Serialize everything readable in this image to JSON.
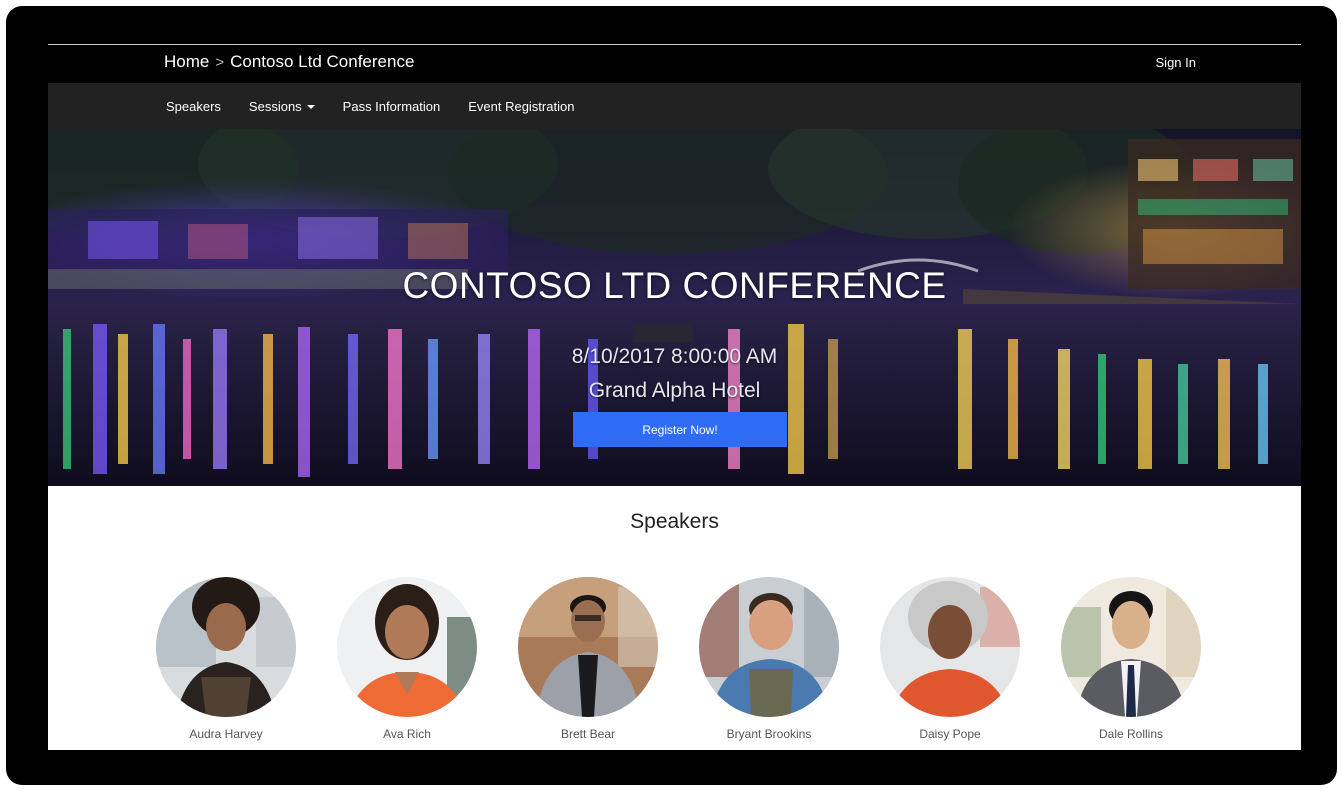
{
  "breadcrumb": {
    "home": "Home",
    "separator": ">",
    "current": "Contoso Ltd Conference"
  },
  "header": {
    "sign_in": "Sign In"
  },
  "nav": {
    "speakers": "Speakers",
    "sessions": "Sessions",
    "pass_information": "Pass Information",
    "event_registration": "Event Registration"
  },
  "hero": {
    "title": "CONTOSO LTD CONFERENCE",
    "date": "8/10/2017 8:00:00 AM",
    "venue": "Grand Alpha Hotel",
    "register_label": "Register Now!"
  },
  "speakers_section": {
    "heading": "Speakers",
    "items": [
      {
        "name": "Audra Harvey"
      },
      {
        "name": "Ava Rich"
      },
      {
        "name": "Brett Bear"
      },
      {
        "name": "Bryant Brookins"
      },
      {
        "name": "Daisy Pope"
      },
      {
        "name": "Dale Rollins"
      }
    ]
  },
  "colors": {
    "accent": "#2f6cf5",
    "navbar": "#222222",
    "topbar": "#000000"
  }
}
